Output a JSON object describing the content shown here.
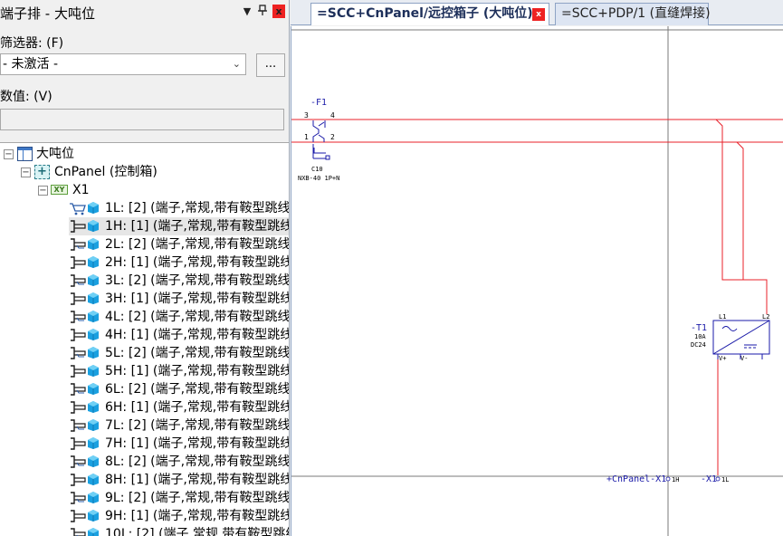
{
  "panel": {
    "title": "端子排 - 大吨位",
    "menu_glyph": "▼",
    "pin_glyph": "ᵗ",
    "close_glyph": "x"
  },
  "filter": {
    "label": "筛选器: (F)",
    "selected": "- 未激活 -",
    "more_label": "..."
  },
  "value": {
    "label": "数值: (V)",
    "current": ""
  },
  "tree": {
    "root": "大吨位",
    "cabinet": "CnPanel (控制箱)",
    "strip": "X1",
    "items": [
      "1L: [2] (端子,常规,带有鞍型跳线",
      "1H: [1] (端子,常规,带有鞍型跳线",
      "2L: [2] (端子,常规,带有鞍型跳线",
      "2H: [1] (端子,常规,带有鞍型跳线",
      "3L: [2] (端子,常规,带有鞍型跳线",
      "3H: [1] (端子,常规,带有鞍型跳线",
      "4L: [2] (端子,常规,带有鞍型跳线",
      "4H: [1] (端子,常规,带有鞍型跳线",
      "5L: [2] (端子,常规,带有鞍型跳线",
      "5H: [1] (端子,常规,带有鞍型跳线",
      "6L: [2] (端子,常规,带有鞍型跳线",
      "6H: [1] (端子,常规,带有鞍型跳线",
      "7L: [2] (端子,常规,带有鞍型跳线",
      "7H: [1] (端子,常规,带有鞍型跳线",
      "8L: [2] (端子,常规,带有鞍型跳线",
      "8H: [1] (端子,常规,带有鞍型跳线",
      "9L: [2] (端子,常规,带有鞍型跳线",
      "9H: [1] (端子,常规,带有鞍型跳线",
      "10L: [2] (端子,常规,带有鞍型跳线"
    ],
    "selected_index": 1
  },
  "tabs": [
    {
      "label": "=SCC+CnPanel/远控箱子 (大吨位)",
      "active": true,
      "close_glyph": "x"
    },
    {
      "label": "=SCC+PDP/1 (直缝焊接)",
      "active": false
    }
  ],
  "schematic": {
    "breaker": {
      "tag": "-F1",
      "pin_3": "3",
      "pin_4": "4",
      "pin_1": "1",
      "pin_2": "2",
      "rating": "C10",
      "type": "NXB-40 1P+N"
    },
    "power_supply": {
      "tag": "-T1",
      "current": "10A",
      "voltage": "DC24",
      "pin_l1": "L1",
      "pin_l2": "L2",
      "pin_vplus": "V+",
      "pin_vminus": "V-"
    },
    "terminal_ref_1": "+CnPanel-X1",
    "terminal_ref_1_pin": "1H",
    "terminal_ref_2": "-X1",
    "terminal_ref_2_pin": "1L"
  },
  "colors": {
    "wire": "#e8202a",
    "schematic_text": "#1a1aa8",
    "grid_line": "#7a7a7a"
  }
}
